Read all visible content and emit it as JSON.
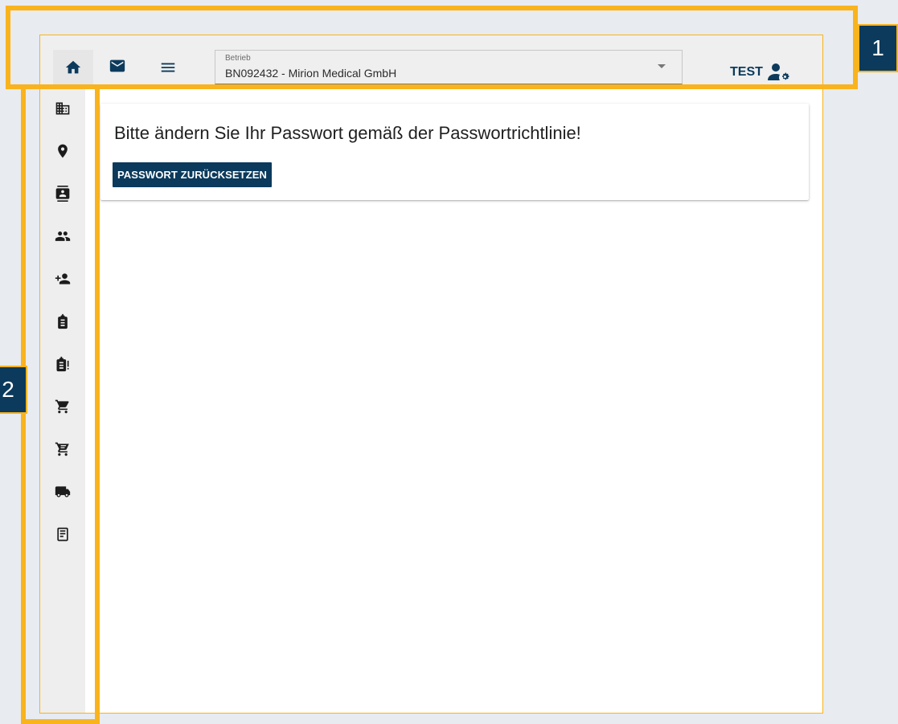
{
  "header": {
    "company_select": {
      "label": "Betrieb",
      "value": "BN092432 - Mirion Medical GmbH"
    },
    "user": {
      "name": "TEST"
    }
  },
  "notice": {
    "message": "Bitte ändern Sie Ihr Passwort gemäß der Passwortrichtlinie!",
    "button_label": "PASSWORT ZURÜCKSETZEN"
  },
  "annotations": [
    {
      "label": "1"
    },
    {
      "label": "2"
    }
  ],
  "colors": {
    "brand": "#0b3a5c",
    "highlight": "#f9b31c",
    "background": "#e8ebef"
  },
  "icons": {
    "top": [
      "home-icon",
      "mail-icon",
      "menu-icon"
    ],
    "user": "user-settings-icon",
    "sidebar": [
      "building-icon",
      "location-pin-icon",
      "contact-card-icon",
      "group-icon",
      "add-person-icon",
      "badge-icon",
      "badge-alert-icon",
      "cart-icon",
      "cart-list-icon",
      "truck-icon",
      "receipt-icon"
    ]
  }
}
